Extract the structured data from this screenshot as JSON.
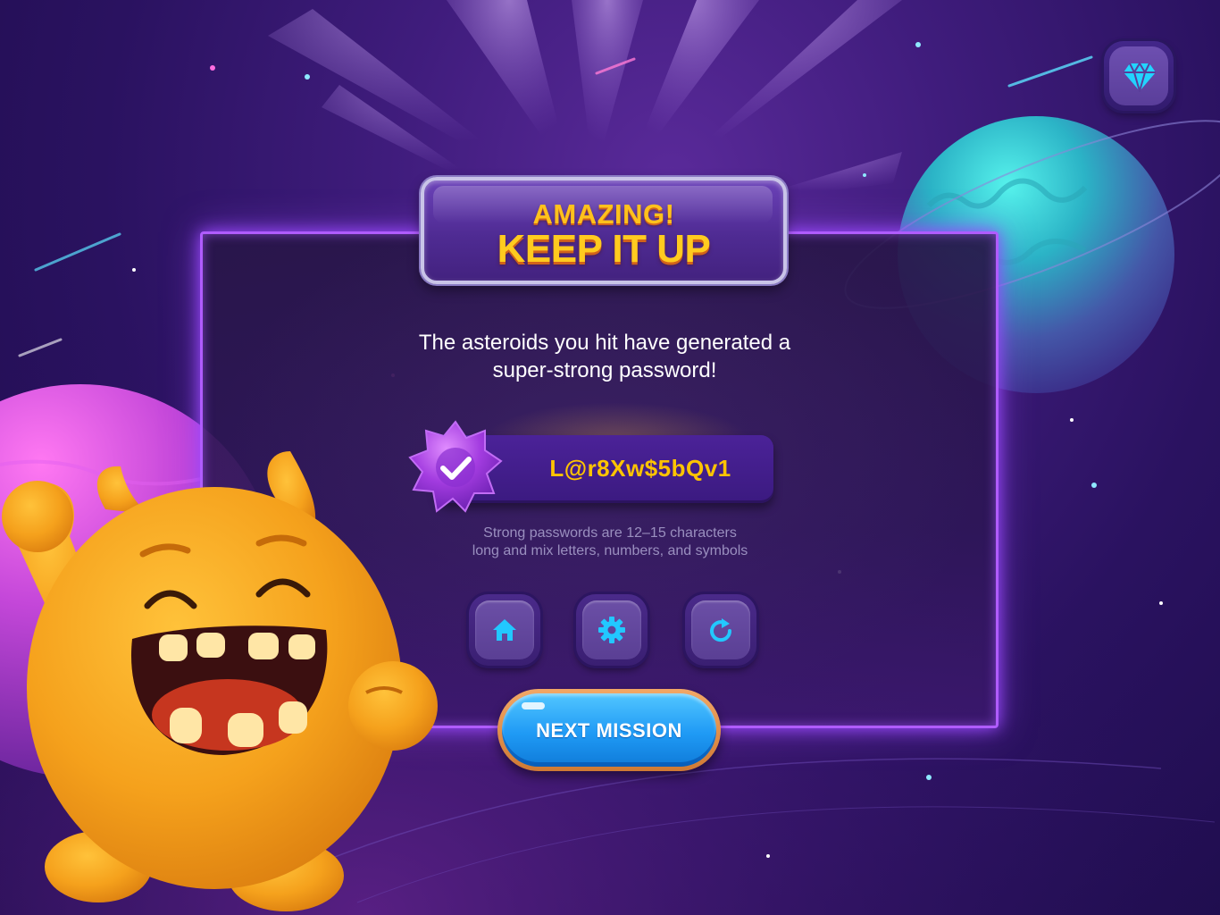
{
  "title": {
    "line1": "AMAZING!",
    "line2": "KEEP IT UP"
  },
  "message": {
    "line1": "The asteroids you hit have generated a",
    "line2": "super-strong password!"
  },
  "password": {
    "value": "L@r8Xw$5bQv1",
    "badge_icon": "check-icon"
  },
  "hint": {
    "line1": "Strong passwords are 12–15 characters",
    "line2": "long and mix letters, numbers, and symbols"
  },
  "actions": [
    {
      "icon": "home-icon"
    },
    {
      "icon": "gear-icon"
    },
    {
      "icon": "replay-icon"
    }
  ],
  "next_button": {
    "label": "NEXT MISSION"
  },
  "top_right": {
    "icon": "diamond-icon"
  },
  "colors": {
    "panel_border": "#b05cff",
    "title_yellow": "#ffc21c",
    "password_text": "#ffc400",
    "button_blue": "#1f9af5",
    "icon_cyan": "#22c8ff"
  }
}
